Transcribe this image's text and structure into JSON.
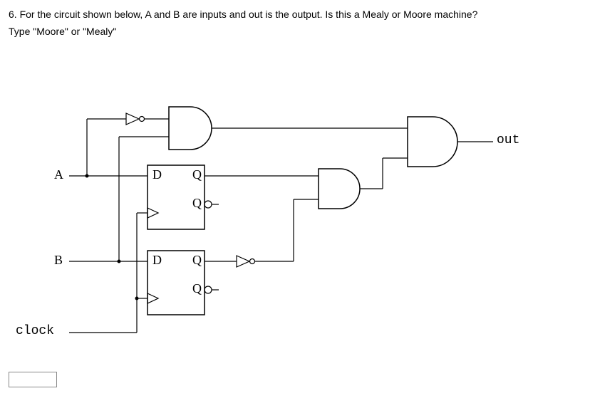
{
  "question": {
    "number": "6.",
    "text": "For the circuit shown below, A and B are inputs and out is the output. Is this a Mealy or Moore machine?",
    "instruction": "Type \"Moore\" or \"Mealy\""
  },
  "diagram": {
    "inputA": "A",
    "inputB": "B",
    "clock": "clock",
    "output": "out",
    "ff1": {
      "d": "D",
      "q": "Q",
      "qbar": "Q"
    },
    "ff2": {
      "d": "D",
      "q": "Q",
      "qbar": "Q"
    }
  },
  "input": {
    "value": "",
    "placeholder": ""
  }
}
